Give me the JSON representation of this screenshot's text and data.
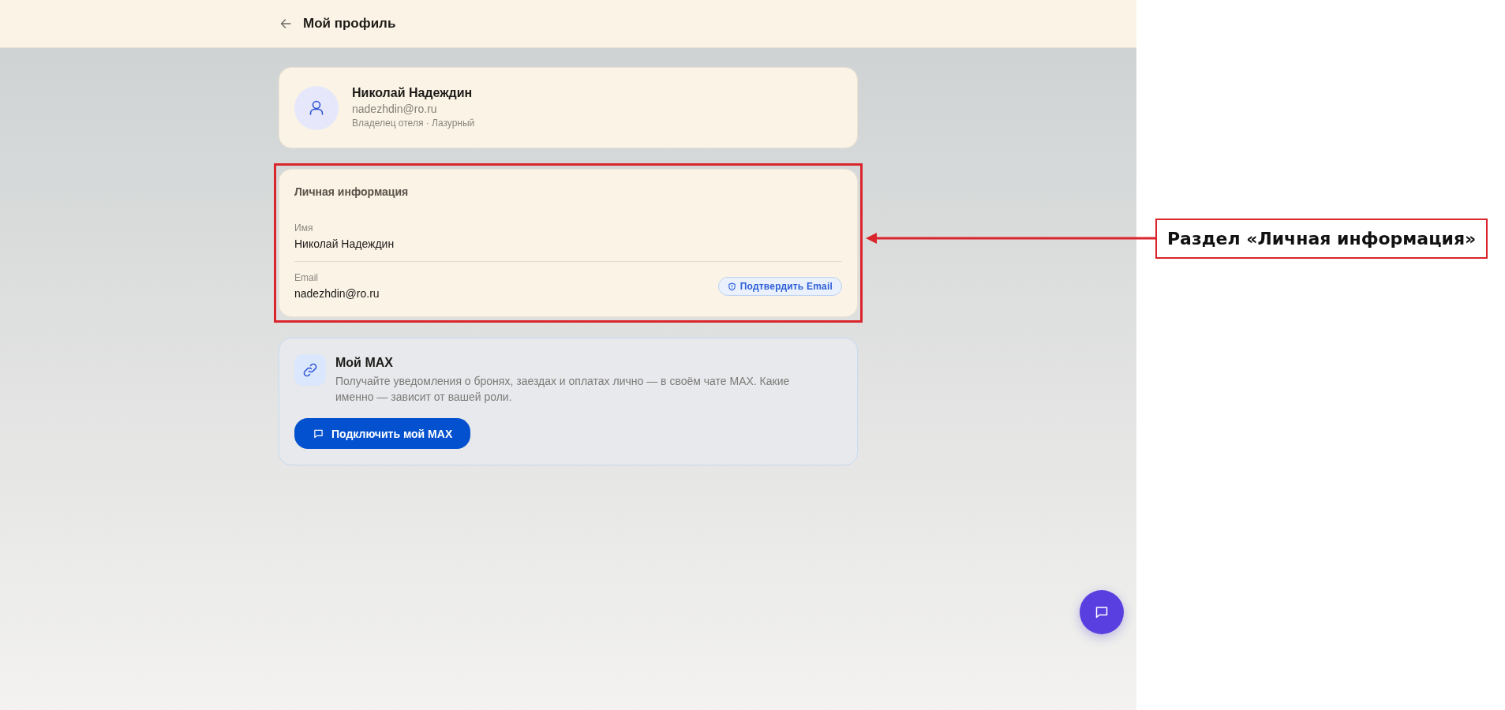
{
  "header": {
    "title": "Мой профиль"
  },
  "profile": {
    "name": "Николай Надеждин",
    "email": "nadezhdin@ro.ru",
    "role": "Владелец отеля · Лазурный"
  },
  "personal_info": {
    "title": "Личная информация",
    "fields": [
      {
        "label": "Имя",
        "value": "Николай Надеждин"
      },
      {
        "label": "Email",
        "value": "nadezhdin@ro.ru",
        "action": "Подтвердить Email"
      }
    ]
  },
  "max": {
    "title": "Мой MAX",
    "description": "Получайте уведомления о бронях, заездах и оплатах лично — в своём чате MAX. Какие именно — зависит от вашей роли.",
    "button": "Подключить мой MAX"
  },
  "annotation": {
    "label": "Раздел «Личная информация»"
  }
}
